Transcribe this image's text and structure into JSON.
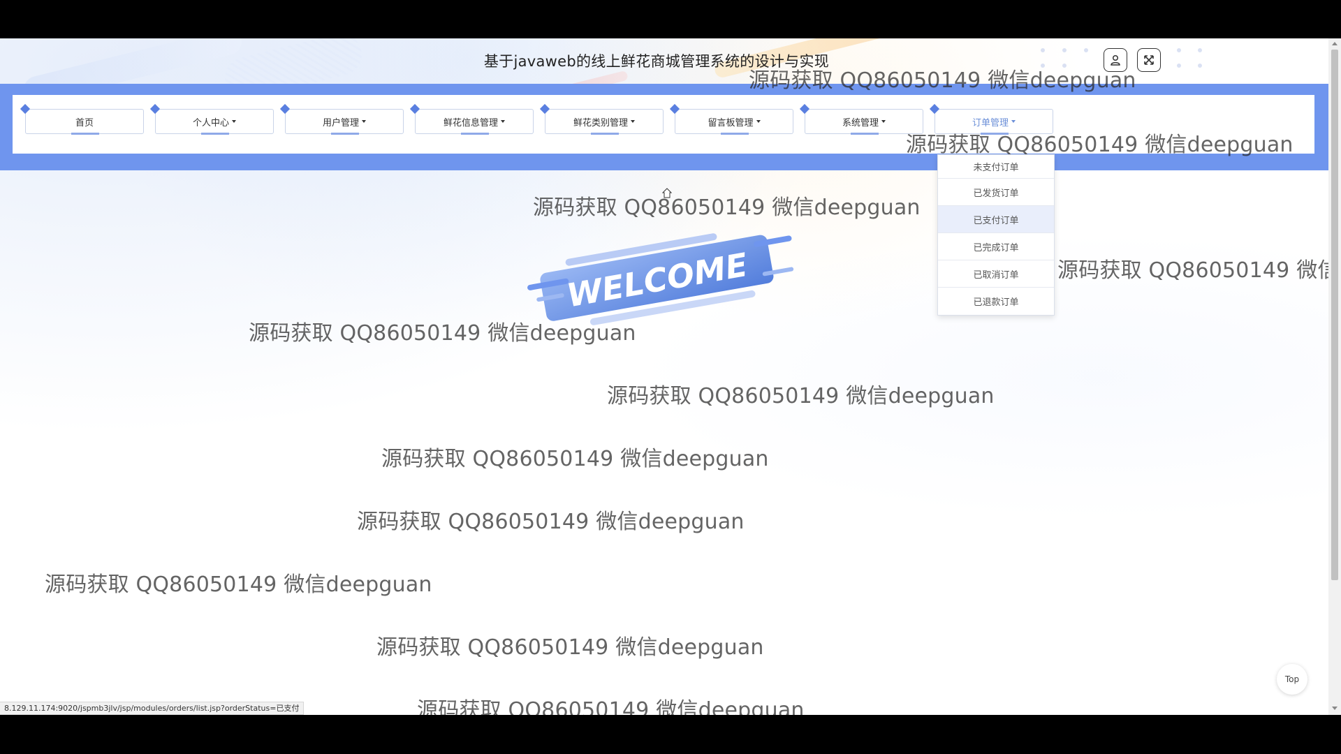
{
  "header": {
    "title": "基于javaweb的线上鲜花商城管理系统的设计与实现",
    "user_icon": "user-icon",
    "fullscreen_icon": "fullscreen-toggle-icon"
  },
  "nav": {
    "items": [
      {
        "label": "首页",
        "has_caret": false
      },
      {
        "label": "个人中心",
        "has_caret": true
      },
      {
        "label": "用户管理",
        "has_caret": true
      },
      {
        "label": "鲜花信息管理",
        "has_caret": true
      },
      {
        "label": "鲜花类别管理",
        "has_caret": true
      },
      {
        "label": "留言板管理",
        "has_caret": true
      },
      {
        "label": "系统管理",
        "has_caret": true
      },
      {
        "label": "订单管理",
        "has_caret": true,
        "active": true
      }
    ],
    "dropdown": [
      "未支付订单",
      "已发货订单",
      "已支付订单",
      "已完成订单",
      "已取消订单",
      "已退款订单"
    ],
    "dropdown_hover_index": 2
  },
  "welcome_text": "WELCOME",
  "watermark": "源码获取 QQ86050149 微信deepguan",
  "status_url": "8.129.11.174:9020/jspmb3jlv/jsp/modules/orders/list.jsp?orderStatus=已支付",
  "top_button": "Top",
  "colors": {
    "nav_band": "#6f95ee",
    "accent": "#5a7fe0",
    "active_text": "#6b8fd8"
  }
}
